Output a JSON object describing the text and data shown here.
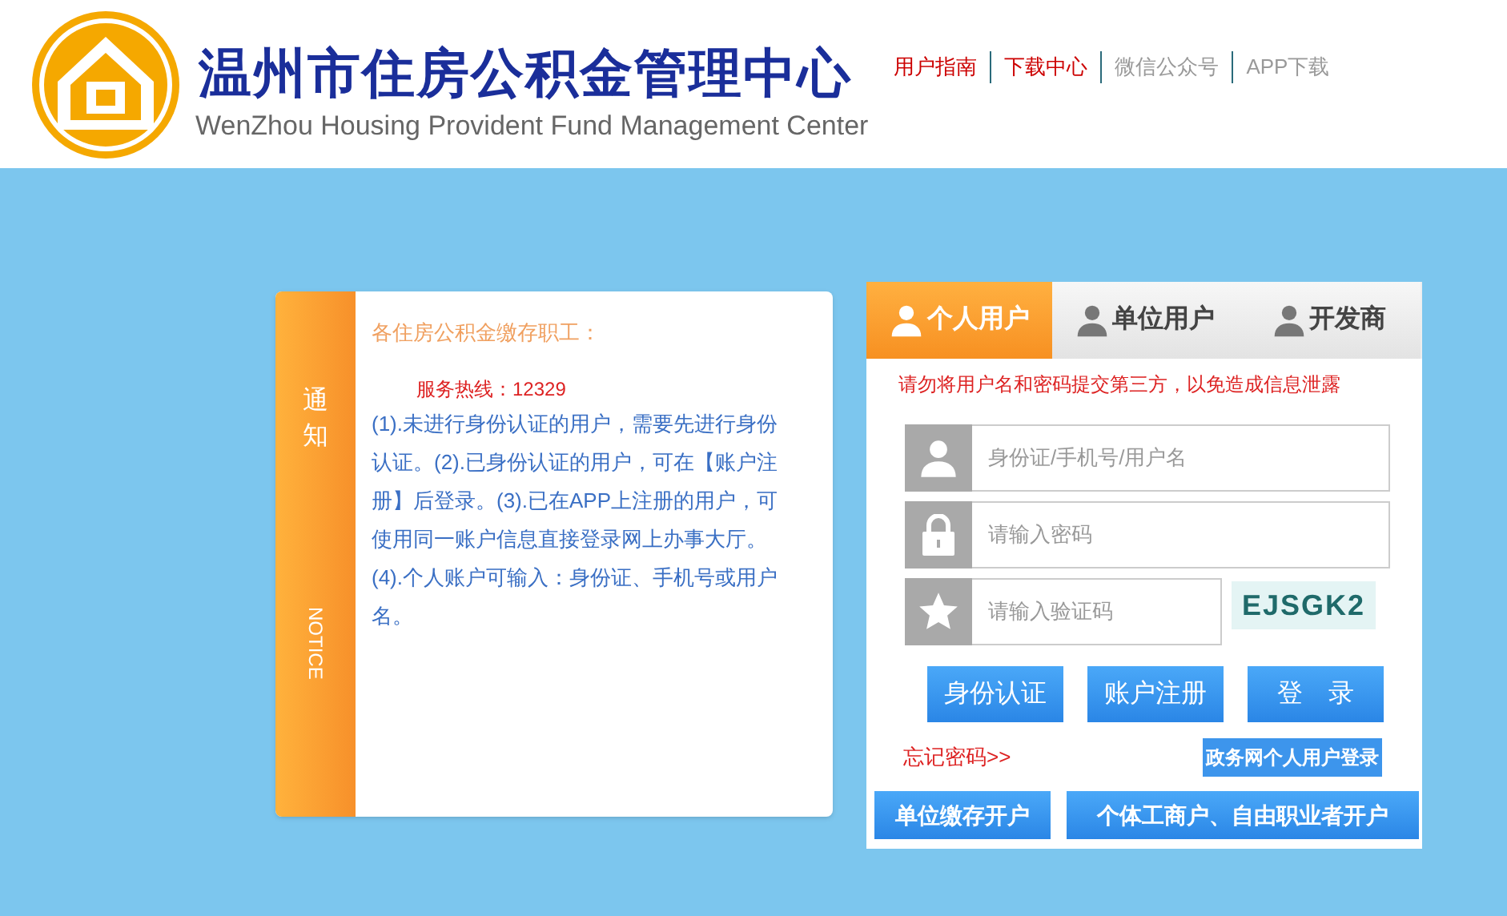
{
  "header": {
    "title": "温州市住房公积金管理中心",
    "subtitle": "WenZhou Housing Provident Fund Management Center",
    "links": [
      {
        "label": "用户指南",
        "color": "#cc0000"
      },
      {
        "label": "下载中心",
        "color": "#cc0000"
      },
      {
        "label": "微信公众号",
        "color": "#999999"
      },
      {
        "label": "APP下载",
        "color": "#999999"
      }
    ]
  },
  "notice": {
    "tab_title": "通知",
    "tab_subtitle": "NOTICE",
    "greeting": "各住房公积金缴存职工：",
    "hotline": "服务热线：12329",
    "body": "(1).未进行身份认证的用户，需要先进行身份认证。(2).已身份认证的用户，可在【账户注册】后登录。(3).已在APP上注册的用户，可使用同一账户信息直接登录网上办事大厅。(4).个人账户可输入：身份证、手机号或用户名。"
  },
  "login": {
    "tabs": [
      {
        "label": "个人用户",
        "selected": true
      },
      {
        "label": "单位用户",
        "selected": false
      },
      {
        "label": "开发商",
        "selected": false
      }
    ],
    "warning": "请勿将用户名和密码提交第三方，以免造成信息泄露",
    "fields": [
      {
        "kind": "user",
        "placeholder": "身份证/手机号/用户名"
      },
      {
        "kind": "password",
        "placeholder": "请输入密码"
      },
      {
        "kind": "captcha",
        "placeholder": "请输入验证码"
      }
    ],
    "captcha": "EJSGK2",
    "buttons": [
      "身份认证",
      "账户注册",
      "登　录"
    ],
    "forgot": "忘记密码>>",
    "gov_login": "政务网个人用户登录",
    "bottom_buttons": [
      "单位缴存开户",
      "个体工商户、自由职业者开户"
    ]
  }
}
